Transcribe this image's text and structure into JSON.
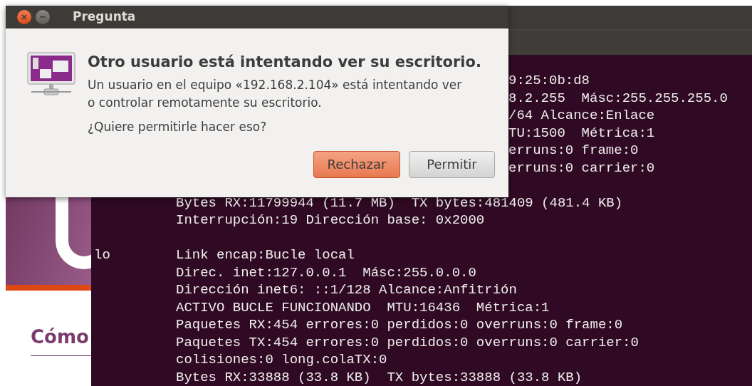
{
  "web_page": {
    "heading": "Cómo"
  },
  "terminal": {
    "lines": [
      {
        "kind": "clipped",
        "text": "9:25:0b:d8"
      },
      {
        "kind": "clipped",
        "text": "8.2.255  Másc:255.255.255.0"
      },
      {
        "kind": "clipped",
        "text": "/64 Alcance:Enlace"
      },
      {
        "kind": "clipped",
        "text": "TU:1500  Métrica:1"
      },
      {
        "kind": "clipped",
        "text": "erruns:0 frame:0"
      },
      {
        "kind": "clipped",
        "text": "erruns:0 carrier:0"
      },
      {
        "kind": "blank"
      },
      {
        "kind": "full",
        "text": "Bytes RX:11799944 (11.7 MB)  TX bytes:481409 (481.4 KB)"
      },
      {
        "kind": "full",
        "text": "Interrupción:19 Dirección base: 0x2000"
      },
      {
        "kind": "blank"
      },
      {
        "kind": "full",
        "iface": "lo",
        "text": "Link encap:Bucle local"
      },
      {
        "kind": "full",
        "text": "Direc. inet:127.0.0.1  Másc:255.0.0.0"
      },
      {
        "kind": "full",
        "text": "Dirección inet6: ::1/128 Alcance:Anfitrión"
      },
      {
        "kind": "full",
        "text": "ACTIVO BUCLE FUNCIONANDO  MTU:16436  Métrica:1"
      },
      {
        "kind": "full",
        "text": "Paquetes RX:454 errores:0 perdidos:0 overruns:0 frame:0"
      },
      {
        "kind": "full",
        "text": "Paquetes TX:454 errores:0 perdidos:0 overruns:0 carrier:0"
      },
      {
        "kind": "full",
        "text": "colisiones:0 long.colaTX:0"
      },
      {
        "kind": "full",
        "text": "Bytes RX:33888 (33.8 KB)  TX bytes:33888 (33.8 KB)"
      }
    ]
  },
  "dialog": {
    "title": "Pregunta",
    "heading": "Otro usuario está intentando ver su escritorio.",
    "message": "Un usuario en el equipo «192.168.2.104» está intentando ver o controlar remotamente su escritorio.",
    "question": "¿Quiere permitirle hacer eso?",
    "buttons": [
      {
        "label": "Rechazar",
        "default": true
      },
      {
        "label": "Permitir",
        "default": false
      }
    ]
  }
}
